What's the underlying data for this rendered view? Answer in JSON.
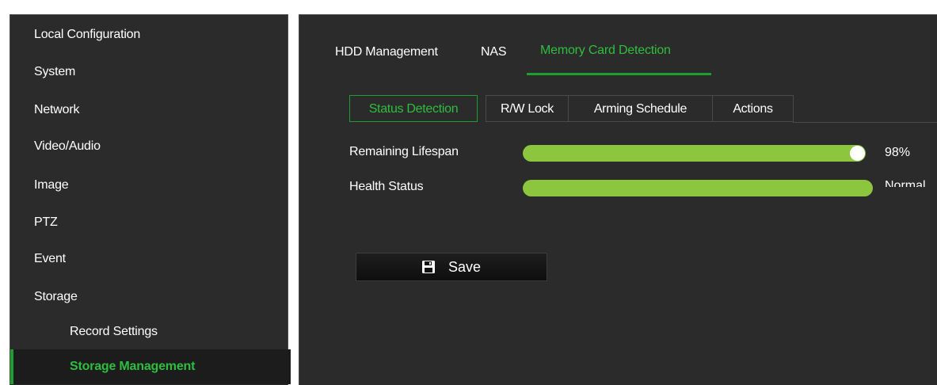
{
  "sidebar": {
    "items": [
      {
        "label": "Local Configuration"
      },
      {
        "label": "System"
      },
      {
        "label": "Network"
      },
      {
        "label": "Video/Audio"
      },
      {
        "label": "Image"
      },
      {
        "label": "PTZ"
      },
      {
        "label": "Event"
      },
      {
        "label": "Storage"
      },
      {
        "label": "Record Settings"
      },
      {
        "label": "Storage Management"
      }
    ]
  },
  "tabs": [
    {
      "label": "HDD Management"
    },
    {
      "label": "NAS"
    },
    {
      "label": "Memory Card Detection"
    }
  ],
  "subtabs": [
    {
      "label": "Status Detection"
    },
    {
      "label": "R/W Lock"
    },
    {
      "label": "Arming Schedule"
    },
    {
      "label": "Actions"
    }
  ],
  "status": {
    "remaining_lifespan_label": "Remaining Lifespan",
    "remaining_lifespan_value": "98%",
    "remaining_lifespan_fraction": 0.98,
    "health_label": "Health Status",
    "health_value": "Normal"
  },
  "save_label": "Save",
  "colors": {
    "accent": "#2fbd3e",
    "bar": "#8cc63f",
    "panel": "#2b2b2b"
  }
}
